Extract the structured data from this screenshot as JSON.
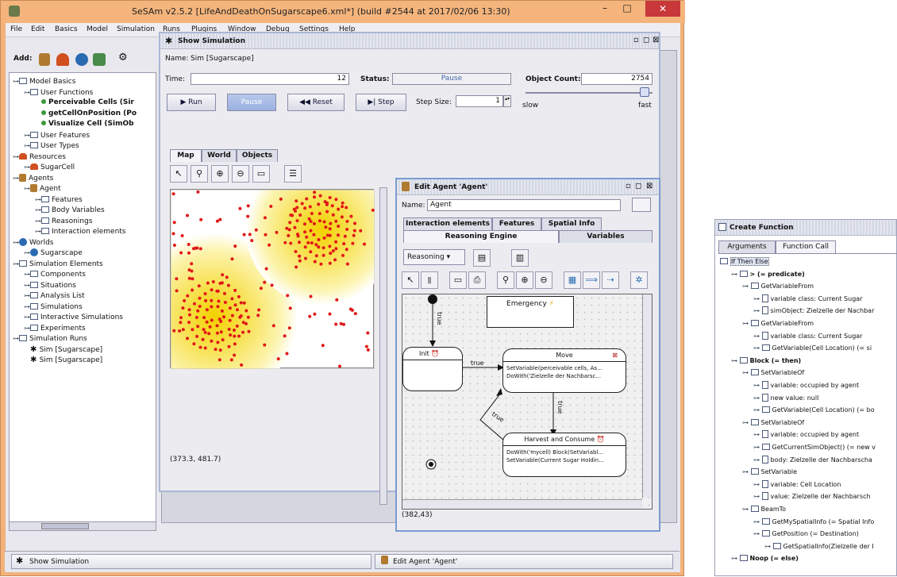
{
  "window": {
    "title": "SeSAm v2.5.2 [LifeAndDeathOnSugarscape6.xml*] (build #2544 at 2017/02/06 13:30)",
    "min": "–",
    "max": "□",
    "close": "✕"
  },
  "menu": [
    "File",
    "Edit",
    "Basics",
    "Model",
    "Simulation",
    "Runs",
    "Plugins",
    "Window",
    "Debug",
    "Settings",
    "Help"
  ],
  "toolbar": {
    "add_label": "Add:"
  },
  "tree": [
    {
      "d": 0,
      "t": "Model Basics",
      "k": "ic"
    },
    {
      "d": 1,
      "t": "User Functions",
      "k": "ic"
    },
    {
      "d": 2,
      "t": "Perceivable Cells (Sir",
      "k": "dot",
      "b": true
    },
    {
      "d": 2,
      "t": "getCellOnPosition (Po",
      "k": "dot",
      "b": true
    },
    {
      "d": 2,
      "t": "Visualize Cell (SimOb",
      "k": "dot",
      "b": true
    },
    {
      "d": 1,
      "t": "User Features",
      "k": "ic"
    },
    {
      "d": 1,
      "t": "User Types",
      "k": "ic"
    },
    {
      "d": 0,
      "t": "Resources",
      "k": "res"
    },
    {
      "d": 1,
      "t": "SugarCell",
      "k": "res"
    },
    {
      "d": 0,
      "t": "Agents",
      "k": "ag"
    },
    {
      "d": 1,
      "t": "Agent",
      "k": "ag"
    },
    {
      "d": 2,
      "t": "Features",
      "k": "ic"
    },
    {
      "d": 2,
      "t": "Body Variables",
      "k": "ic"
    },
    {
      "d": 2,
      "t": "Reasonings",
      "k": "ic"
    },
    {
      "d": 2,
      "t": "Interaction elements",
      "k": "ic"
    },
    {
      "d": 0,
      "t": "Worlds",
      "k": "wo"
    },
    {
      "d": 1,
      "t": "Sugarscape",
      "k": "wo"
    },
    {
      "d": 0,
      "t": "Simulation Elements",
      "k": "ic"
    },
    {
      "d": 1,
      "t": "Components",
      "k": "ic"
    },
    {
      "d": 1,
      "t": "Situations",
      "k": "ic"
    },
    {
      "d": 1,
      "t": "Analysis List",
      "k": "ic"
    },
    {
      "d": 1,
      "t": "Simulations",
      "k": "ic"
    },
    {
      "d": 1,
      "t": "Interactive Simulations",
      "k": "ic"
    },
    {
      "d": 1,
      "t": "Experiments",
      "k": "ic"
    },
    {
      "d": 0,
      "t": "Simulation Runs",
      "k": "ic"
    },
    {
      "d": 1,
      "t": "Sim [Sugarscape]",
      "k": "run"
    },
    {
      "d": 1,
      "t": "Sim [Sugarscape]",
      "k": "run"
    }
  ],
  "sim": {
    "title": "Show Simulation",
    "name_label": "Name:",
    "name_value": "Sim [Sugarscape]",
    "time_label": "Time:",
    "time_value": "12",
    "status_label": "Status:",
    "status_value": "Pause",
    "count_label": "Object Count:",
    "count_value": "2754",
    "run": "Run",
    "pause": "Pause",
    "reset": "Reset",
    "step": "Step",
    "step_size_label": "Step Size:",
    "step_size": "1",
    "slow": "slow",
    "fast": "fast",
    "tabs": [
      "Map",
      "World",
      "Objects"
    ],
    "coords": "(373.3, 481.7)"
  },
  "agent": {
    "title": "Edit Agent 'Agent'",
    "name_label": "Name:",
    "name_value": "Agent",
    "tabs1": [
      "Interaction elements",
      "Features",
      "Spatial Info"
    ],
    "tabs2": [
      "Reasoning Engine",
      "Variables"
    ],
    "reasoning": "Reasoning",
    "coords": "(382,43)",
    "nodes": {
      "emergency": "Emergency",
      "init": "Init",
      "move": "Move",
      "move_l1": "SetVariable(perceivable cells, As...",
      "move_l2": "DoWith('Zielzelle der Nachbarsc...",
      "harvest": "Harvest and Consume",
      "harvest_l1": "DoWith('mycell) Block(SetVariabl...",
      "harvest_l2": "SetVariable(Current Sugar Holdin..."
    },
    "edges": [
      "true",
      "true",
      "true",
      "true"
    ]
  },
  "taskbar": [
    "Show Simulation",
    "Edit Agent 'Agent'"
  ],
  "cf": {
    "title": "Create Function",
    "tabs": [
      "Arguments",
      "Function Call"
    ],
    "rows": [
      {
        "d": 0,
        "t": "If Then Else",
        "k": "ic",
        "sel": true
      },
      {
        "d": 1,
        "t": "> (= predicate)",
        "k": "ic",
        "b": true
      },
      {
        "d": 2,
        "t": "GetVariableFrom",
        "k": "ic"
      },
      {
        "d": 3,
        "t": "variable class: Current Sugar",
        "k": "doc"
      },
      {
        "d": 3,
        "t": "simObject: Zielzelle der Nachbar",
        "k": "doc"
      },
      {
        "d": 2,
        "t": "GetVariableFrom",
        "k": "ic"
      },
      {
        "d": 3,
        "t": "variable class: Current Sugar",
        "k": "doc"
      },
      {
        "d": 3,
        "t": "GetVariable(Cell Location) (= si",
        "k": "ic"
      },
      {
        "d": 1,
        "t": "Block (= then)",
        "k": "ic",
        "b": true
      },
      {
        "d": 2,
        "t": "SetVariableOf",
        "k": "ic"
      },
      {
        "d": 3,
        "t": "variable: occupied by agent",
        "k": "doc"
      },
      {
        "d": 3,
        "t": "new value: null",
        "k": "doc"
      },
      {
        "d": 3,
        "t": "GetVariable(Cell Location) (= bo",
        "k": "ic"
      },
      {
        "d": 2,
        "t": "SetVariableOf",
        "k": "ic"
      },
      {
        "d": 3,
        "t": "variable: occupied by agent",
        "k": "doc"
      },
      {
        "d": 3,
        "t": "GetCurrentSimObject() (= new v",
        "k": "ic"
      },
      {
        "d": 3,
        "t": "body: Zielzelle der Nachbarscha",
        "k": "doc"
      },
      {
        "d": 2,
        "t": "SetVariable",
        "k": "ic"
      },
      {
        "d": 3,
        "t": "variable: Cell Location",
        "k": "doc"
      },
      {
        "d": 3,
        "t": "value: Zielzelle der Nachbarsch",
        "k": "doc"
      },
      {
        "d": 2,
        "t": "BeamTo",
        "k": "ic"
      },
      {
        "d": 3,
        "t": "GetMySpatialInfo (= Spatial Info",
        "k": "ic"
      },
      {
        "d": 3,
        "t": "GetPosition (= Destination)",
        "k": "ic"
      },
      {
        "d": 4,
        "t": "GetSpatialInfo(Zielzelle der I",
        "k": "ic"
      },
      {
        "d": 1,
        "t": "Noop (= else)",
        "k": "ic",
        "b": true
      }
    ]
  },
  "colors": {
    "title_bar": "#f4b47c",
    "close": "#c8383a",
    "accent": "#7a9ad0",
    "agent_dot": "#e01818"
  }
}
